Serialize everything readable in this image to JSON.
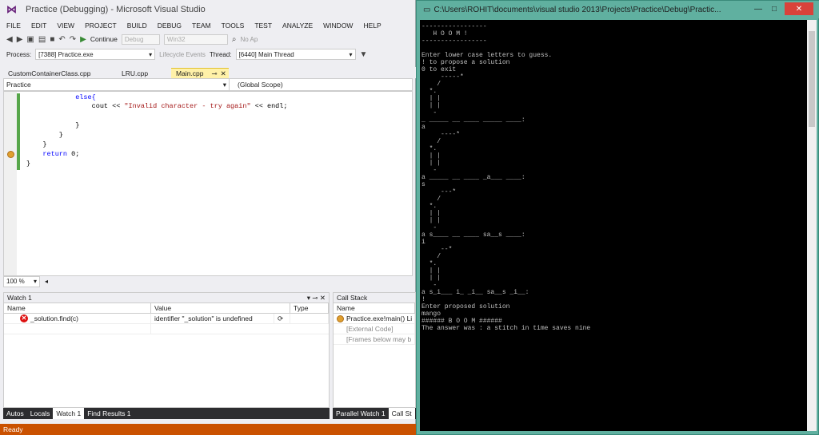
{
  "vs": {
    "title": "Practice (Debugging) - Microsoft Visual Studio",
    "menu": [
      "FILE",
      "EDIT",
      "VIEW",
      "PROJECT",
      "BUILD",
      "DEBUG",
      "TEAM",
      "TOOLS",
      "TEST",
      "ANALYZE",
      "WINDOW",
      "HELP"
    ],
    "toolbar": {
      "continue": "Continue",
      "config": "Debug",
      "platform": "Win32",
      "noap": "No Ap"
    },
    "toolbar2": {
      "process_label": "Process:",
      "process_value": "[7388] Practice.exe",
      "lifecycle": "Lifecycle Events",
      "thread_label": "Thread:",
      "thread_value": "[6440] Main Thread"
    },
    "tabs": [
      "CustomContainerClass.cpp",
      "LRU.cpp",
      "Main.cpp"
    ],
    "nav": {
      "scope_left": "Practice",
      "scope_right": "(Global Scope)"
    },
    "code": [
      "            else{",
      "                cout << \"Invalid character - try again\" << endl;",
      "",
      "            }",
      "        }",
      "    }",
      "    return 0;",
      "}"
    ],
    "zoom": "100 %",
    "watch": {
      "title": "Watch 1",
      "cols": [
        "Name",
        "Value",
        "Type"
      ],
      "rows": [
        {
          "name": "_solution.find(c)",
          "value": "identifier \"_solution\" is undefined",
          "type": ""
        }
      ]
    },
    "callstack": {
      "title": "Call Stack",
      "cols": [
        "Name"
      ],
      "rows": [
        "Practice.exe!main() Li",
        "[External Code]",
        "[Frames below may b"
      ]
    },
    "bottom_tabs_left": [
      "Autos",
      "Locals",
      "Watch 1",
      "Find Results 1"
    ],
    "bottom_tabs_right": [
      "Parallel Watch 1",
      "Call St"
    ],
    "status": "Ready"
  },
  "console": {
    "title": "C:\\Users\\ROHIT\\documents\\visual studio 2013\\Projects\\Practice\\Debug\\Practic...",
    "lines": [
      "-----------------",
      "   H O O M !",
      "-----------------",
      "",
      "Enter lower case letters to guess.",
      "! to propose a solution",
      "0 to exit",
      "     -----*",
      "    /",
      "  *.",
      "  | |",
      "  | |",
      "   -",
      "_ _____ __ ____ _____ ____:",
      "a",
      "     ----*",
      "    /",
      "  *.",
      "  | |",
      "  | |",
      "   -",
      "a _____ __ ____ _a___ ____:",
      "s",
      "     ---*",
      "    /",
      "  *.",
      "  | |",
      "  | |",
      "   -",
      "a s____ __ ____ sa__s ____:",
      "i",
      "     --*",
      "    /",
      "  *.",
      "  | |",
      "  | |",
      "   -",
      "a s_i___ i_ _i__ sa__s _i__:",
      "!",
      "Enter proposed solution",
      "mango",
      "###### B O O M ######",
      "The answer was : a stitch in time saves nine"
    ]
  }
}
